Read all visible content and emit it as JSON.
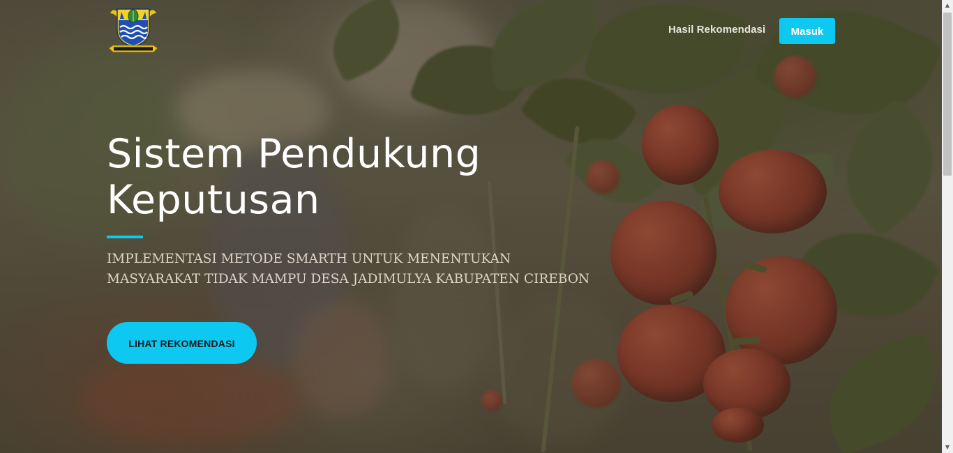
{
  "nav": {
    "logo_caption": "GEMAH RIPAH LOH JINAWI",
    "results_link": "Hasil Rekomendasi",
    "login_button": "Masuk"
  },
  "hero": {
    "title": "Sistem Pendukung Keputusan",
    "subtitle": "IMPLEMENTASI METODE SMARTH UNTUK MENENTUKAN MASYARAKAT TIDAK MAMPU DESA JADIMULYA KABUPATEN CIREBON",
    "cta_label": "LIHAT REKOMENDASI"
  },
  "colors": {
    "accent": "#0dc8f1",
    "overlay": "#3c3424",
    "title_text": "#ffffff",
    "subtitle_text": "#dcd6c8"
  },
  "icons": {
    "logo": "cirebon-regency-emblem-icon",
    "scroll_up": "scroll-up-arrow-icon",
    "scroll_down": "scroll-down-arrow-icon"
  }
}
